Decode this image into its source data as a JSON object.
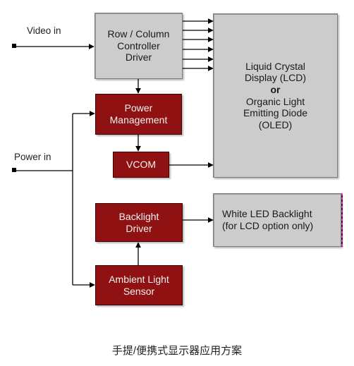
{
  "diagram": {
    "title_caption": "手提/便携式显示器应用方案",
    "colors": {
      "red_block": "#8f1111",
      "gray_block": "#cccccc",
      "wire": "#000000",
      "text_dark": "#1a1a1a",
      "text_light": "#f2f2f2",
      "accent_edge": "#e0309a"
    },
    "inputs": [
      {
        "id": "video-in",
        "label": "Video in"
      },
      {
        "id": "power-in",
        "label": "Power in"
      }
    ],
    "blocks": [
      {
        "id": "row-column-controller-driver",
        "label": "Row / Column\nController\nDriver",
        "style": "gray"
      },
      {
        "id": "liquid-crystal-display",
        "label_line1": "Liquid Crystal",
        "label_line2": "Display (LCD)",
        "label_line3": "or",
        "label_line4": "Organic Light",
        "label_line5": "Emitting Diode",
        "label_line6": "(OLED)",
        "style": "gray"
      },
      {
        "id": "power-management",
        "label": "Power\nManagement",
        "style": "red"
      },
      {
        "id": "vcom",
        "label": "VCOM",
        "style": "red"
      },
      {
        "id": "backlight-driver",
        "label": "Backlight\nDriver",
        "style": "red"
      },
      {
        "id": "white-led-backlight",
        "label": "White LED Backlight\n(for LCD option only)",
        "style": "gray"
      },
      {
        "id": "ambient-light-sensor",
        "label": "Ambient Light\nSensor",
        "style": "red"
      }
    ],
    "connections": [
      {
        "from": "video-in",
        "to": "row-column-controller-driver",
        "count": 1
      },
      {
        "from": "row-column-controller-driver",
        "to": "liquid-crystal-display",
        "count": 6
      },
      {
        "from": "row-column-controller-driver",
        "to": "power-management",
        "count": 1
      },
      {
        "from": "power-in",
        "to": "power-management",
        "count": 1
      },
      {
        "from": "power-in",
        "to": "ambient-light-sensor",
        "count": 1
      },
      {
        "from": "power-management",
        "to": "vcom",
        "count": 1
      },
      {
        "from": "vcom",
        "to": "liquid-crystal-display",
        "count": 1
      },
      {
        "from": "backlight-driver",
        "to": "white-led-backlight",
        "count": 1
      },
      {
        "from": "ambient-light-sensor",
        "to": "backlight-driver",
        "count": 1
      }
    ]
  }
}
